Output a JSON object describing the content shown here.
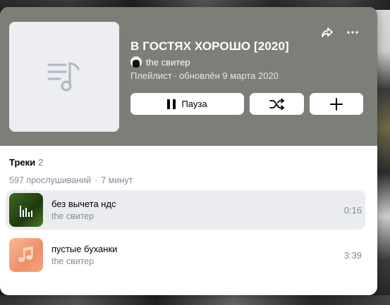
{
  "playlist": {
    "title": "В ГОСТЯХ ХОРОШО [2020]",
    "author": "the свитер",
    "type_label": "Плейлист",
    "updated": "обновлён 9 марта 2020",
    "header_color": "#7b7f77"
  },
  "actions": {
    "pause_label": "Пауза",
    "share_icon": "share-icon",
    "more_icon": "more-icon",
    "shuffle_icon": "shuffle-icon",
    "add_icon": "plus-icon"
  },
  "tracks_section": {
    "title": "Треки",
    "count": "2",
    "listens": "597 прослушиваний",
    "duration_total": "7 минут"
  },
  "tracks": [
    {
      "name": "без вычета ндс",
      "artist": "the свитер",
      "duration": "0:16",
      "playing": true
    },
    {
      "name": "пустые буханки",
      "artist": "the свитер",
      "duration": "3:39",
      "playing": false
    }
  ]
}
